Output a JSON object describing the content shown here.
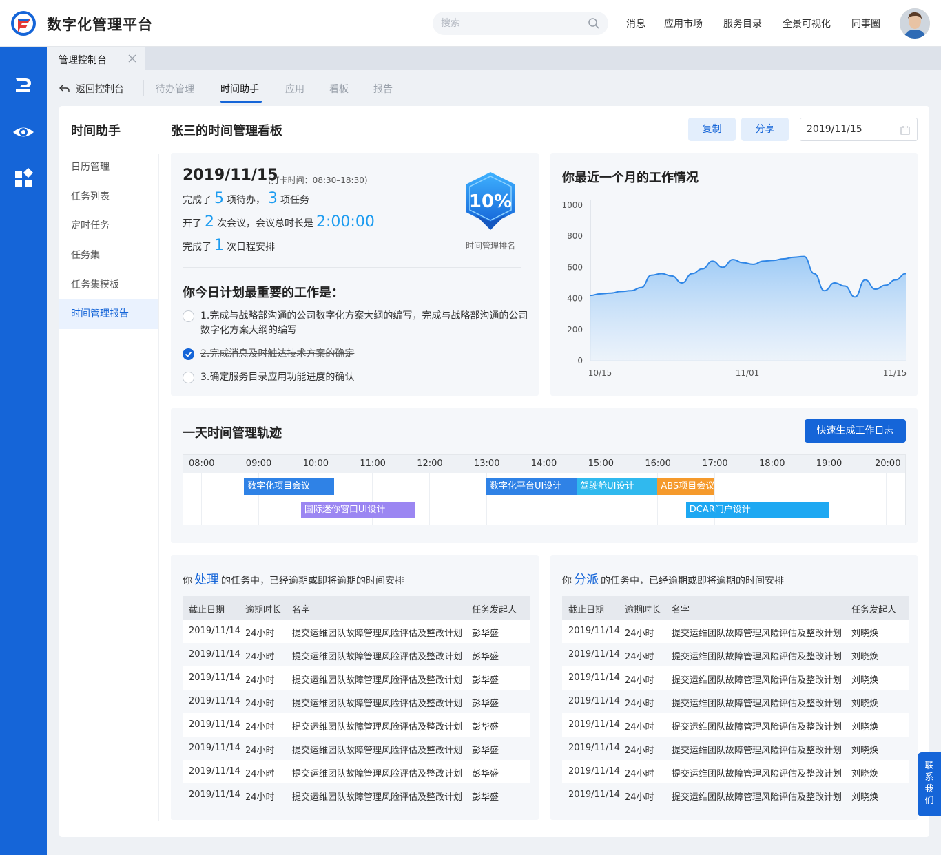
{
  "app": {
    "title": "数字化管理平台"
  },
  "search": {
    "placeholder": "搜索"
  },
  "topnav": [
    "消息",
    "应用市场",
    "服务目录",
    "全景可视化",
    "同事圈"
  ],
  "page_tab": {
    "label": "管理控制台"
  },
  "subnav": {
    "back": "返回控制台",
    "tabs": [
      "待办管理",
      "时间助手",
      "应用",
      "看板",
      "报告"
    ],
    "active": "时间助手"
  },
  "sidebar": {
    "title": "时间助手",
    "items": [
      "日历管理",
      "任务列表",
      "定时任务",
      "任务集",
      "任务集模板",
      "时间管理报告"
    ],
    "active": "时间管理报告"
  },
  "board": {
    "title": "张三的时间管理看板",
    "copy_label": "复制",
    "share_label": "分享",
    "date": "2019/11/15"
  },
  "summary": {
    "date": "2019/11/15",
    "checkin": "(打卡时间：08:30–18:30)",
    "line1_a": "完成了",
    "todo_count": "5",
    "line1_b": "项待办，",
    "task_count": "3",
    "line1_c": "项任务",
    "line2_a": "开了",
    "meeting_count": "2",
    "line2_b": "次会议，会议总时长是",
    "meeting_duration": "2:00:00",
    "line3_a": "完成了",
    "schedule_count": "1",
    "line3_b": "次日程安排",
    "rank_value": "10%",
    "rank_label": "时间管理排名"
  },
  "plan": {
    "title": "你今日计划最重要的工作是：",
    "items": [
      {
        "text": "1.完成与战略部沟通的公司数字化方案大纲的编写，完成与战略部沟通的公司数字化方案大纲的编写",
        "done": false
      },
      {
        "text": "2.完成消息及时触达技术方案的确定",
        "done": true
      },
      {
        "text": "3.确定服务目录应用功能进度的确认",
        "done": false
      }
    ]
  },
  "chart_data": {
    "type": "area",
    "title": "你最近一个月的工作情况",
    "x_ticks": [
      "10/15",
      "11/01",
      "11/15"
    ],
    "y_ticks": [
      0,
      200,
      400,
      600,
      800,
      1000
    ],
    "ylim": [
      0,
      1000
    ],
    "x_index": [
      0,
      1,
      2,
      3,
      4,
      5,
      6,
      7,
      8,
      9,
      10,
      11,
      12,
      13,
      14,
      15,
      16,
      17,
      18,
      19,
      20,
      21,
      22,
      23,
      24,
      25,
      26,
      27,
      28,
      29,
      30,
      31
    ],
    "values": [
      420,
      430,
      435,
      445,
      450,
      470,
      550,
      560,
      545,
      500,
      560,
      590,
      640,
      600,
      650,
      630,
      620,
      640,
      645,
      655,
      665,
      670,
      560,
      450,
      500,
      480,
      410,
      520,
      460,
      485,
      520,
      560
    ]
  },
  "timeline": {
    "title": "一天时间管理轨迹",
    "button": "快速生成工作日志",
    "hours": [
      "08:00",
      "09:00",
      "10:00",
      "11:00",
      "12:00",
      "13:00",
      "14:00",
      "15:00",
      "16:00",
      "17:00",
      "18:00",
      "19:00",
      "20:00"
    ],
    "events": [
      {
        "label": "数字化项目会议",
        "start": "08:45",
        "end": "10:20",
        "color": "#2f82e6"
      },
      {
        "label": "国际迷你窗口UI设计",
        "start": "09:45",
        "end": "11:45",
        "color": "#9b86f2"
      },
      {
        "label": "数字化平台UI设计",
        "start": "13:00",
        "end": "14:35",
        "color": "#2f82e6"
      },
      {
        "label": "驾驶舱UI设计",
        "start": "14:35",
        "end": "16:00",
        "color": "#30b9ee"
      },
      {
        "label": "ABS项目会议",
        "start": "16:00",
        "end": "17:00",
        "color": "#f59a2c"
      },
      {
        "label": "DCAR门户设计",
        "start": "16:30",
        "end": "19:00",
        "color": "#1ea8f2"
      }
    ]
  },
  "tables": {
    "left": {
      "pre": "你",
      "highlight": "处理",
      "post": "的任务中，已经逾期或即将逾期的时间安排",
      "headers": [
        "截止日期",
        "逾期时长",
        "名字",
        "任务发起人"
      ],
      "rows": [
        [
          "2019/11/14",
          "24小时",
          "提交运维团队故障管理风险评估及整改计划",
          "彭华盛"
        ],
        [
          "2019/11/14",
          "24小时",
          "提交运维团队故障管理风险评估及整改计划",
          "彭华盛"
        ],
        [
          "2019/11/14",
          "24小时",
          "提交运维团队故障管理风险评估及整改计划",
          "彭华盛"
        ],
        [
          "2019/11/14",
          "24小时",
          "提交运维团队故障管理风险评估及整改计划",
          "彭华盛"
        ],
        [
          "2019/11/14",
          "24小时",
          "提交运维团队故障管理风险评估及整改计划",
          "彭华盛"
        ],
        [
          "2019/11/14",
          "24小时",
          "提交运维团队故障管理风险评估及整改计划",
          "彭华盛"
        ],
        [
          "2019/11/14",
          "24小时",
          "提交运维团队故障管理风险评估及整改计划",
          "彭华盛"
        ],
        [
          "2019/11/14",
          "24小时",
          "提交运维团队故障管理风险评估及整改计划",
          "彭华盛"
        ]
      ]
    },
    "right": {
      "pre": "你",
      "highlight": "分派",
      "post": "的任务中，已经逾期或即将逾期的时间安排",
      "headers": [
        "截止日期",
        "逾期时长",
        "名字",
        "任务发起人"
      ],
      "rows": [
        [
          "2019/11/14",
          "24小时",
          "提交运维团队故障管理风险评估及整改计划",
          "刘晓焕"
        ],
        [
          "2019/11/14",
          "24小时",
          "提交运维团队故障管理风险评估及整改计划",
          "刘晓焕"
        ],
        [
          "2019/11/14",
          "24小时",
          "提交运维团队故障管理风险评估及整改计划",
          "刘晓焕"
        ],
        [
          "2019/11/14",
          "24小时",
          "提交运维团队故障管理风险评估及整改计划",
          "刘晓焕"
        ],
        [
          "2019/11/14",
          "24小时",
          "提交运维团队故障管理风险评估及整改计划",
          "刘晓焕"
        ],
        [
          "2019/11/14",
          "24小时",
          "提交运维团队故障管理风险评估及整改计划",
          "刘晓焕"
        ],
        [
          "2019/11/14",
          "24小时",
          "提交运维团队故障管理风险评估及整改计划",
          "刘晓焕"
        ],
        [
          "2019/11/14",
          "24小时",
          "提交运维团队故障管理风险评估及整改计划",
          "刘晓焕"
        ]
      ]
    }
  },
  "contact": {
    "label": "联系我们"
  },
  "colors": {
    "primary": "#1565d8",
    "accent": "#1d9cf0",
    "rail": "#1565d8"
  },
  "icons": [
    "logo-icon",
    "search-icon",
    "avatar",
    "pen-icon",
    "eye-icon",
    "apps-icon",
    "close-icon",
    "back-icon",
    "calendar-icon",
    "rank-badge-icon"
  ]
}
